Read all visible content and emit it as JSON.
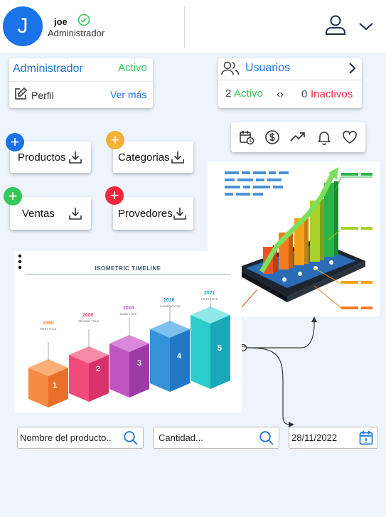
{
  "user": {
    "initial": "J",
    "name": "joe",
    "role": "Administrador"
  },
  "admin_card": {
    "title": "Administrador",
    "status": "Activo",
    "profile_label": "Perfil",
    "more_link": "Ver más"
  },
  "users_card": {
    "title": "Usuarios",
    "active_count": "2",
    "active_label": "Activo",
    "arrows": "‹›",
    "inactive_count": "0",
    "inactive_label": "Inactivos"
  },
  "toolbar_icons": [
    "calendar-clock-icon",
    "dollar-icon",
    "trending-up-icon",
    "bell-icon",
    "heart-icon"
  ],
  "actions": [
    {
      "label": "Productos",
      "badge_color": "#1a73e8"
    },
    {
      "label": "Categorias",
      "badge_color": "#f2b134"
    },
    {
      "label": "Ventas",
      "badge_color": "#34c759"
    },
    {
      "label": "Provedores",
      "badge_color": "#f0263c"
    }
  ],
  "timeline": {
    "title": "ISOMETRIC TIMELINE",
    "steps": [
      {
        "year": "1990",
        "caption": "FIRST TITLE",
        "number": "1"
      },
      {
        "year": "2008",
        "caption": "SECOND TITLE",
        "number": "2"
      },
      {
        "year": "2010",
        "caption": "THIRD TITLE",
        "number": "3"
      },
      {
        "year": "2016",
        "caption": "FOURTH TITLE",
        "number": "4"
      },
      {
        "year": "2021",
        "caption": "FIFTH TITLE",
        "number": "5"
      }
    ]
  },
  "filters": {
    "product_placeholder": "Nombre del producto..",
    "quantity_placeholder": "Cantidad...",
    "date_value": "28/11/2022"
  },
  "colors": {
    "primary": "#1a73e8",
    "active": "#34c759",
    "inactive": "#f0263c",
    "background": "#eef4fc"
  }
}
